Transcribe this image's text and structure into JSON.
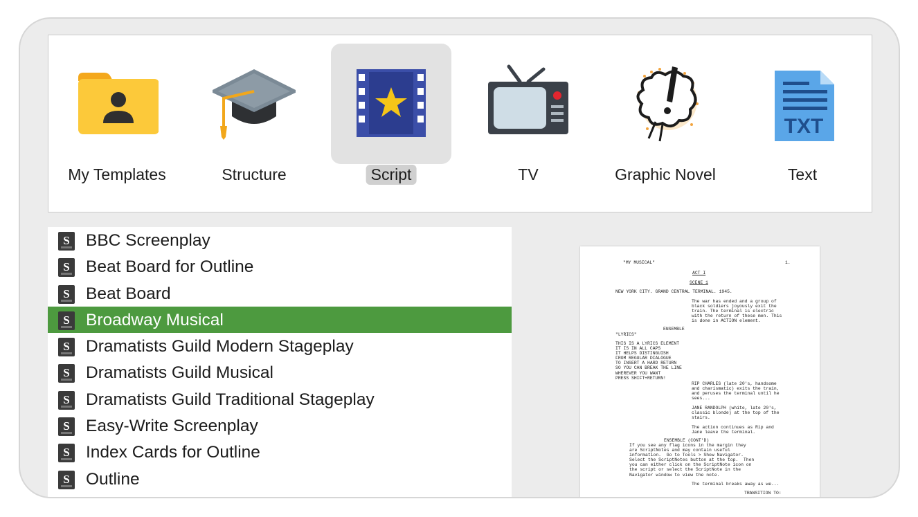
{
  "categories": [
    {
      "label": "My Templates",
      "icon": "folder-person-icon"
    },
    {
      "label": "Structure",
      "icon": "graduation-cap-icon"
    },
    {
      "label": "Script",
      "icon": "film-star-icon",
      "selected": true
    },
    {
      "label": "TV",
      "icon": "tv-icon"
    },
    {
      "label": "Graphic Novel",
      "icon": "comic-burst-icon"
    },
    {
      "label": "Text",
      "icon": "txt-file-icon"
    }
  ],
  "templates": [
    "BBC Screenplay",
    "Beat Board for Outline",
    "Beat Board",
    "Broadway Musical",
    "Dramatists Guild Modern Stageplay",
    "Dramatists Guild Musical",
    "Dramatists Guild Traditional Stageplay",
    "Easy-Write Screenplay",
    "Index Cards for Outline",
    "Outline"
  ],
  "selected_template": "Broadway Musical",
  "colors": {
    "selection_green": "#4d9a3f",
    "folder_yellow": "#fcc93a",
    "film_blue": "#3b4ea8",
    "star_yellow": "#f5c518",
    "txt_blue": "#5aa6e8"
  },
  "preview": {
    "header_left": "\"MY MUSICAL\"",
    "page_number": "1.",
    "act": "ACT I",
    "scene": "SCENE 1",
    "slugline": "NEW YORK CITY. GRAND CENTRAL TERMINAL. 1945.",
    "action_1": "The war has ended and a group of\nblack soldiers joyously exit the\ntrain. The terminal is electric\nwith the return of these men. This\nis done in ACTION element.",
    "character_1": "ENSEMBLE",
    "lyrics_heading": "\"LYRICS\"",
    "lyrics": "THIS IS A LYRICS ELEMENT\nIT IS IN ALL CAPS\nIT HELPS DISTINGUISH\nFROM REGULAR DIALOGUE\nTO INSERT A HARD RETURN\nSO YOU CAN BREAK THE LINE\nWHEREVER YOU WANT\nPRESS SHIFT+RETURN!",
    "action_2": "RIP CHARLES (late 20's, handsome\nand charismatic) exits the train,\nand peruses the terminal until he\nsees...",
    "action_3": "JANE RANDOLPH (white, late 20's,\nclassic blonde) at the top of the\nstairs.",
    "action_4": "The action continues as Rip and\nJane leave the terminal.",
    "character_2": "ENSEMBLE (CONT'D)",
    "dialogue": "If you see any flag icons in the margin they\nare ScriptNotes and may contain useful\ninformation.  Go to Tools > Show Navigator.\nSelect the ScriptNotes button at the top.  Then\nyou can either click on the ScriptNote icon on\nthe script or select the ScriptNote in the\nNavigator window to view the note.",
    "action_5": "The terminal breaks away as we...",
    "transition": "TRANSITION TO:"
  }
}
